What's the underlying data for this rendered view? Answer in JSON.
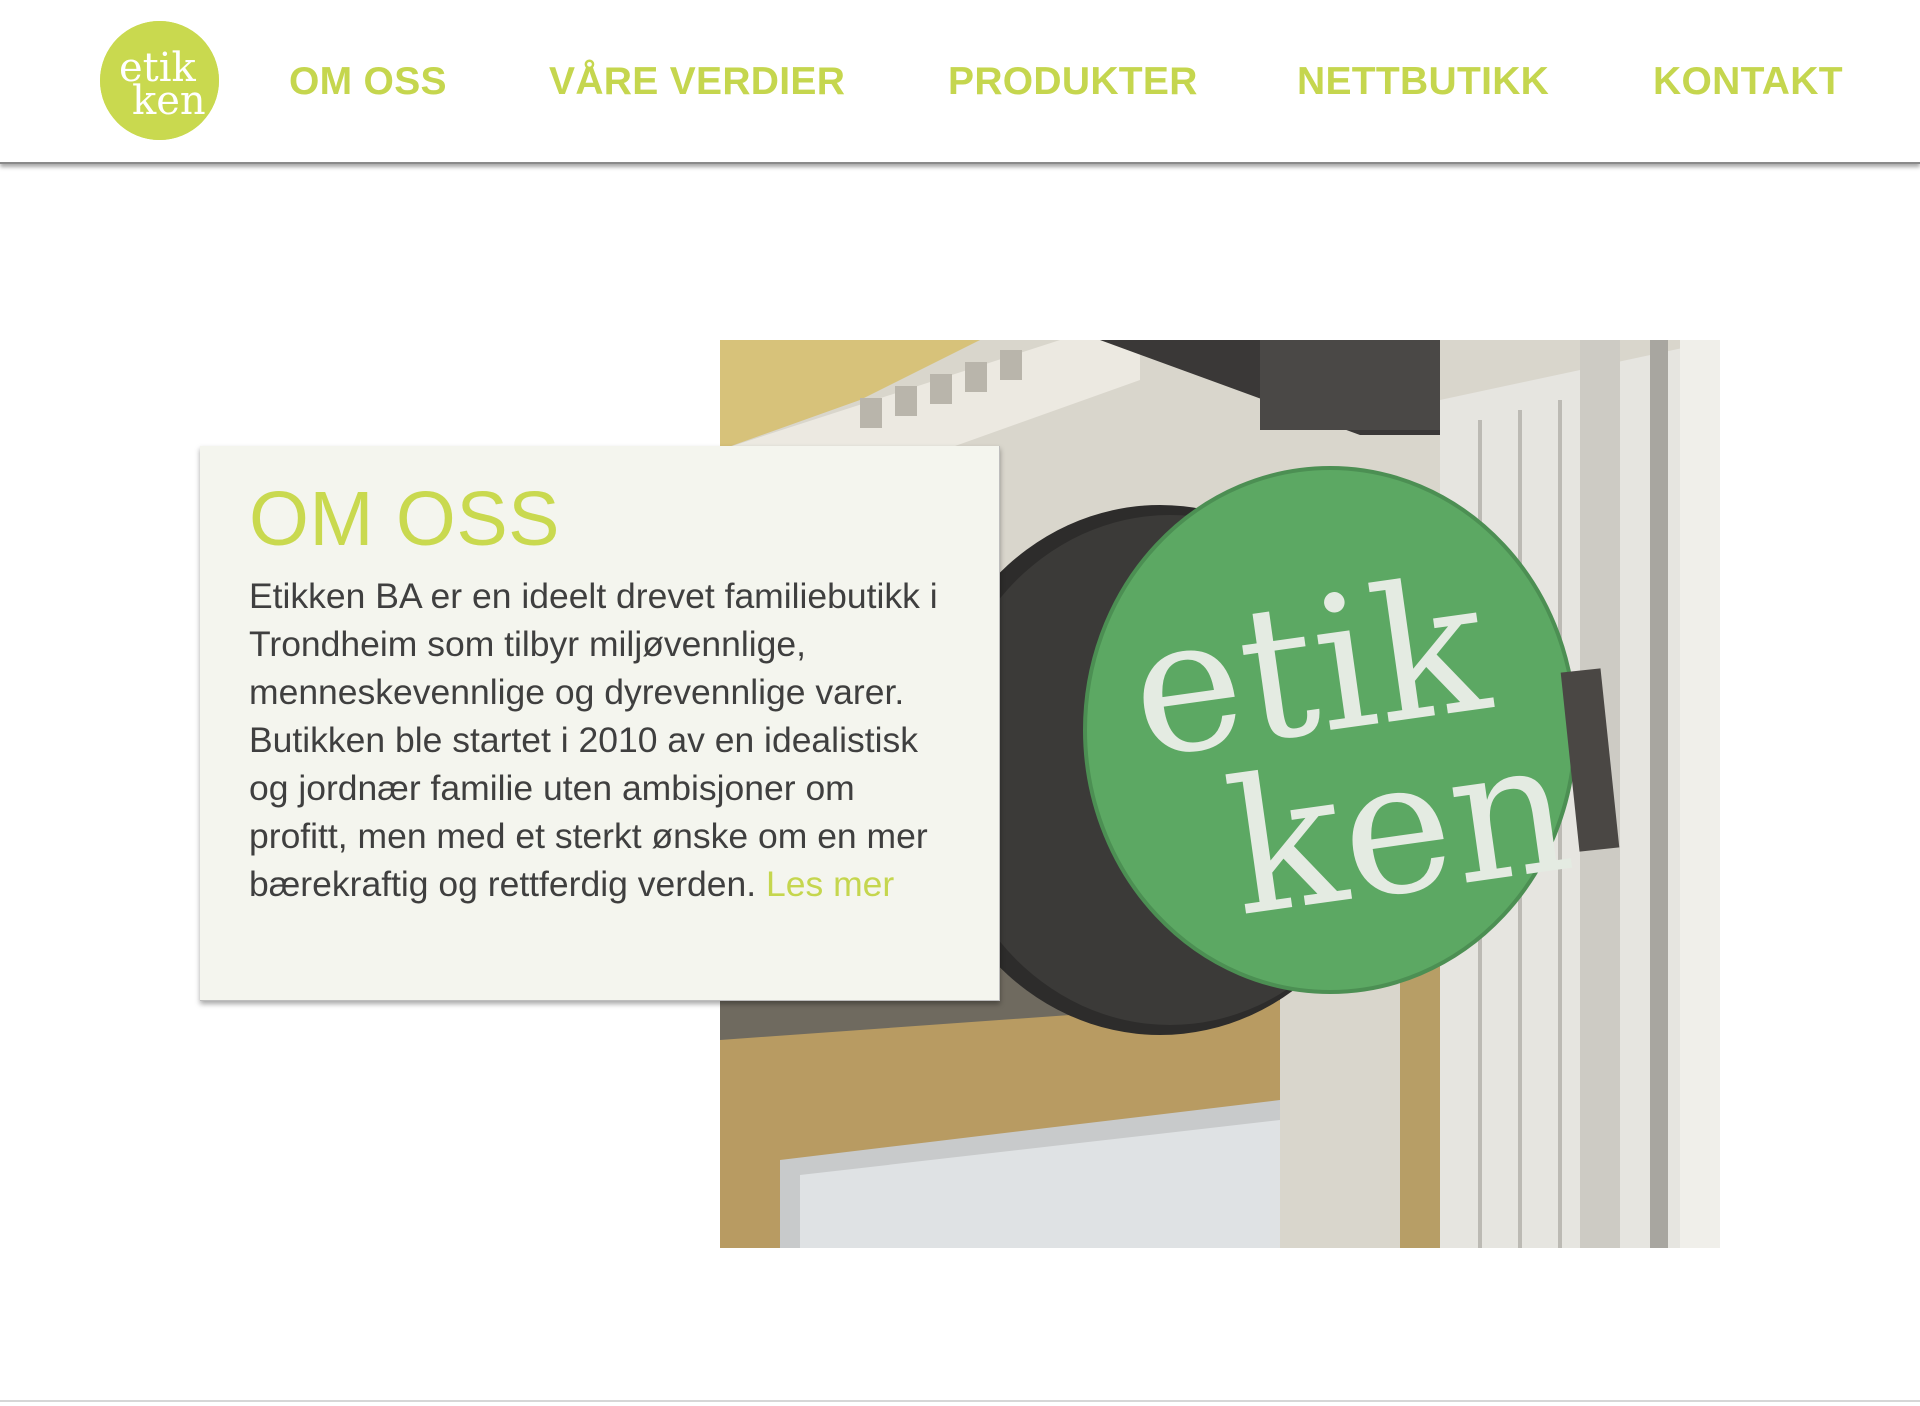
{
  "brand": {
    "logo_line1": "etik",
    "logo_line2": "ken",
    "accent_color": "#c9d94f",
    "logo_icon": "etikken-logo"
  },
  "nav": {
    "items": [
      {
        "label": "OM OSS"
      },
      {
        "label": "VÅRE VERDIER"
      },
      {
        "label": "PRODUKTER"
      },
      {
        "label": "NETTBUTIKK"
      },
      {
        "label": "KONTAKT"
      }
    ]
  },
  "about": {
    "title": "OM OSS",
    "body": "Etikken BA er en ideelt drevet familiebutikk i Trondheim som tilbyr miljøvennlige, menneskevennlige og dyrevennlige varer. Butikken ble startet i 2010 av en idealistisk og jordnær familie uten ambisjoner om profitt, men med et sterkt ønske om en mer bærekraftig og rettferdig verden.",
    "read_more": "Les mer"
  },
  "hero": {
    "sign_line1": "etik",
    "sign_line2": "ken",
    "sign_color": "#5ca863"
  }
}
